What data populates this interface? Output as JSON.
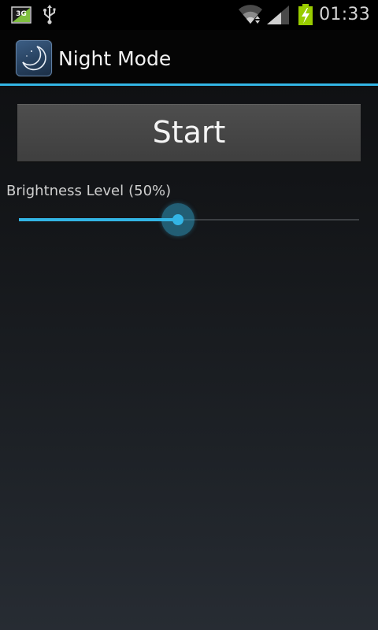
{
  "status_bar": {
    "network_badge": "3G",
    "time": "01:33",
    "icons": [
      "network-3g-icon",
      "usb-icon",
      "wifi-icon",
      "cell-signal-icon",
      "battery-charging-icon"
    ]
  },
  "action_bar": {
    "title": "Night Mode",
    "icon": "moon-icon"
  },
  "main": {
    "start_label": "Start",
    "brightness": {
      "label": "Brightness Level",
      "value_text": "(50%)",
      "value": 0.5
    }
  },
  "colors": {
    "accent": "#33b5e5",
    "battery": "#99cc00",
    "button": "#484848",
    "background_top": "#0c0d0f",
    "background_bottom": "#272c33"
  }
}
